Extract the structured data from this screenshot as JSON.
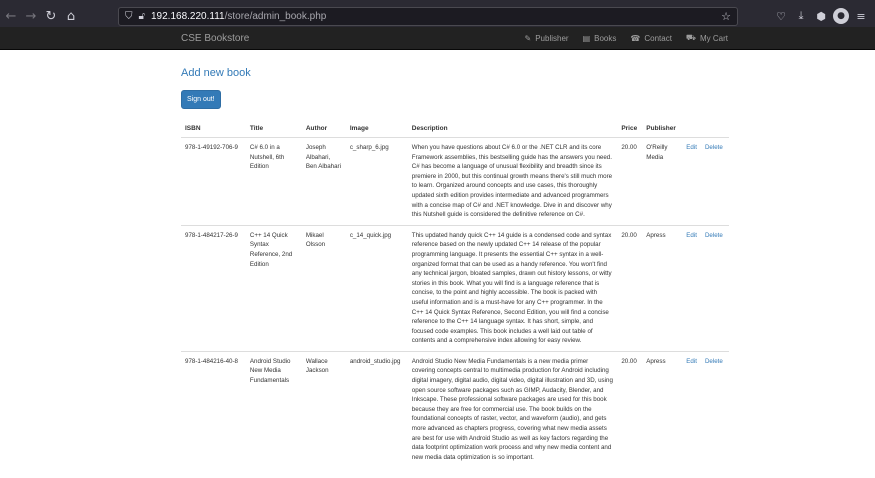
{
  "browser": {
    "url_host": "192.168.220.111",
    "url_path": "/store/admin_book.php"
  },
  "site": {
    "brand": "CSE Bookstore",
    "nav": [
      {
        "label": "Publisher",
        "icon": "paperclip-icon"
      },
      {
        "label": "Books",
        "icon": "book-icon"
      },
      {
        "label": "Contact",
        "icon": "phone-icon"
      },
      {
        "label": "My Cart",
        "icon": "cart-icon"
      }
    ]
  },
  "page": {
    "heading": "Add new book",
    "signout_label": "Sign out!"
  },
  "table": {
    "headers": [
      "ISBN",
      "Title",
      "Author",
      "Image",
      "Description",
      "Price",
      "Publisher",
      "",
      ""
    ],
    "edit_label": "Edit",
    "delete_label": "Delete",
    "rows": [
      {
        "isbn": "978-1-49192-706-9",
        "title": "C# 6.0 in a Nutshell, 6th Edition",
        "author": "Joseph Albahari, Ben Albahari",
        "image": "c_sharp_6.jpg",
        "description": "When you have questions about C# 6.0 or the .NET CLR and its core Framework assemblies, this bestselling guide has the answers you need. C# has become a language of unusual flexibility and breadth since its premiere in 2000, but this continual growth means there's still much more to learn. Organized around concepts and use cases, this thoroughly updated sixth edition provides intermediate and advanced programmers with a concise map of C# and .NET knowledge. Dive in and discover why this Nutshell guide is considered the definitive reference on C#.",
        "price": "20.00",
        "publisher": "O'Reilly Media"
      },
      {
        "isbn": "978-1-484217-26-9",
        "title": "C++ 14 Quick Syntax Reference, 2nd Edition",
        "author": "Mikael Olsson",
        "image": "c_14_quick.jpg",
        "description": "This updated handy quick C++ 14 guide is a condensed code and syntax reference based on the newly updated C++ 14 release of the popular programming language. It presents the essential C++ syntax in a well-organized format that can be used as a handy reference. You won't find any technical jargon, bloated samples, drawn out history lessons, or witty stories in this book. What you will find is a language reference that is concise, to the point and highly accessible. The book is packed with useful information and is a must-have for any C++ programmer. In the C++ 14 Quick Syntax Reference, Second Edition, you will find a concise reference to the C++ 14 language syntax. It has short, simple, and focused code examples. This book includes a well laid out table of contents and a comprehensive index allowing for easy review.",
        "price": "20.00",
        "publisher": "Apress"
      },
      {
        "isbn": "978-1-484216-40-8",
        "title": "Android Studio New Media Fundamentals",
        "author": "Wallace Jackson",
        "image": "android_studio.jpg",
        "description": "Android Studio New Media Fundamentals is a new media primer covering concepts central to multimedia production for Android including digital imagery, digital audio, digital video, digital illustration and 3D, using open source software packages such as GIMP, Audacity, Blender, and Inkscape. These professional software packages are used for this book because they are free for commercial use. The book builds on the foundational concepts of raster, vector, and waveform (audio), and gets more advanced as chapters progress, covering what new media assets are best for use with Android Studio as well as key factors regarding the data footprint optimization work process and why new media content and new media data optimization is so important.",
        "price": "20.00",
        "publisher": "Apress"
      }
    ]
  }
}
